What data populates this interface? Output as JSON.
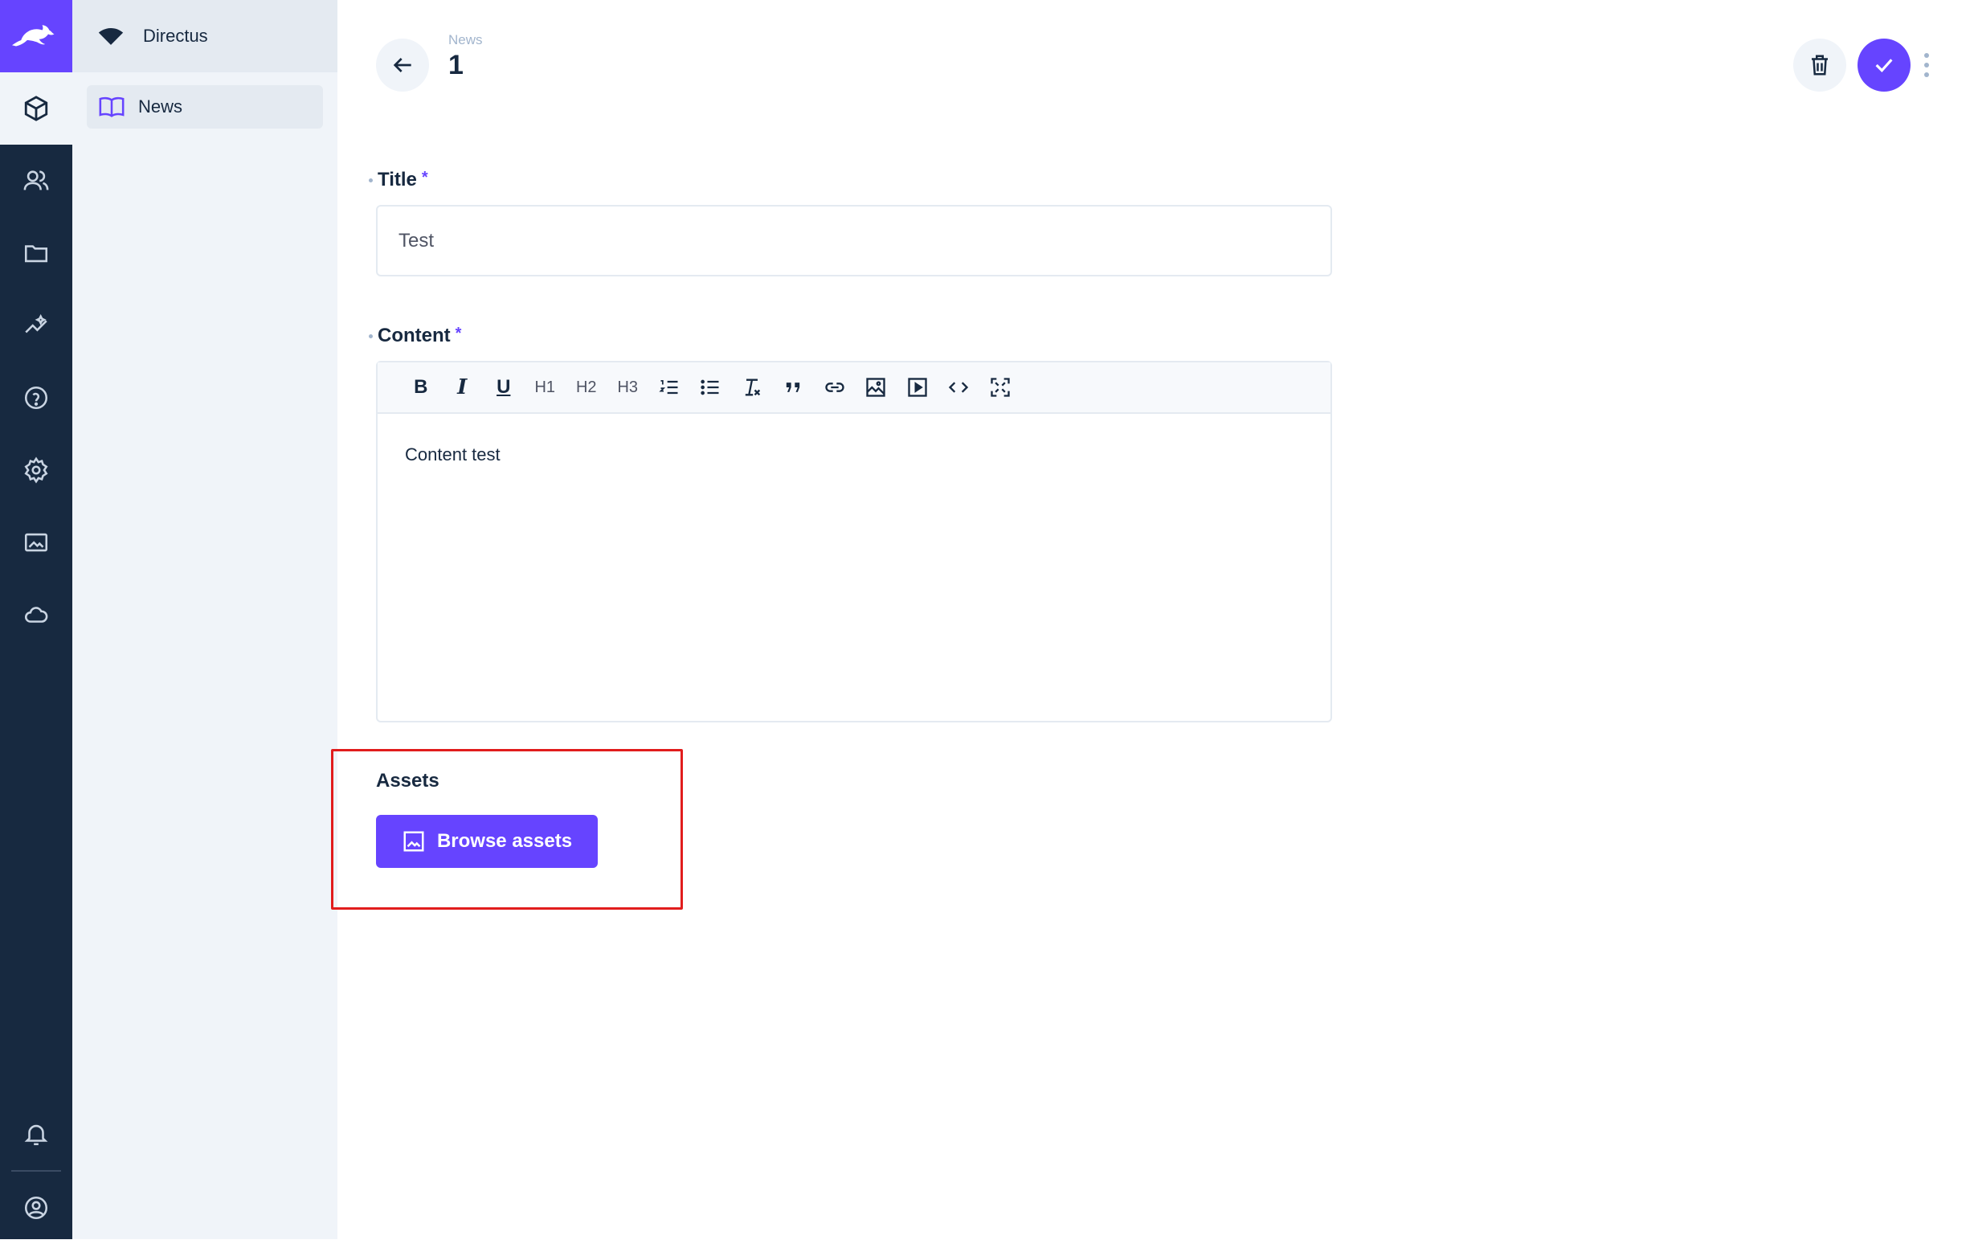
{
  "app": {
    "project_name": "Directus",
    "accent": "#6644ff",
    "rail_color": "#172940"
  },
  "rail": {
    "modules": [
      "content-icon",
      "users-icon",
      "files-icon",
      "insights-icon",
      "docs-icon",
      "settings-icon",
      "marketplace-icon",
      "cloud-icon"
    ],
    "bottom": [
      "notifications-icon",
      "user-account-icon"
    ]
  },
  "nav": {
    "items": [
      {
        "label": "News",
        "icon": "book-icon"
      }
    ]
  },
  "header": {
    "breadcrumb": "News",
    "title": "1"
  },
  "form": {
    "title_label": "Title",
    "title_value": "Test",
    "content_label": "Content",
    "content_value": "Content test",
    "required_mark": "*",
    "toolbar": [
      "B",
      "I",
      "U",
      "H1",
      "H2",
      "H3",
      "ordered-list-icon",
      "bullet-list-icon",
      "clear-format-icon",
      "blockquote-icon",
      "link-icon",
      "image-icon",
      "media-icon",
      "code-icon",
      "fullscreen-icon"
    ],
    "assets_label": "Assets",
    "browse_label": "Browse assets"
  },
  "annotation": {
    "highlight_color": "#e11d1d"
  }
}
